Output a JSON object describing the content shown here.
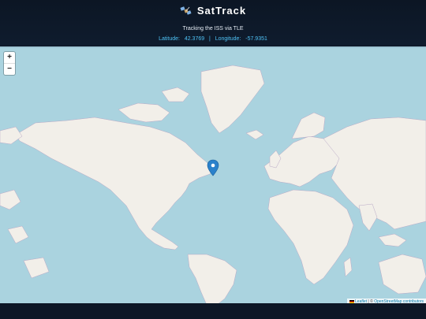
{
  "app": {
    "title": "SatTrack",
    "icon": "satellite-icon",
    "subtitle": "Tracking the ISS via TLE",
    "coords": {
      "latitude_label": "Latitude:",
      "latitude": "42.3769",
      "separator": "|",
      "longitude_label": "Longitude:",
      "longitude": "-57.9351"
    }
  },
  "map": {
    "zoom_in": "+",
    "zoom_out": "−",
    "attribution": {
      "leaflet": "Leaflet",
      "separator": "| ©",
      "osm": "OpenStreetMap contributors"
    },
    "marker_icon": "map-pin-icon",
    "colors": {
      "water": "#aad3df",
      "land": "#f2efe9",
      "marker": "#2a81cb"
    }
  }
}
